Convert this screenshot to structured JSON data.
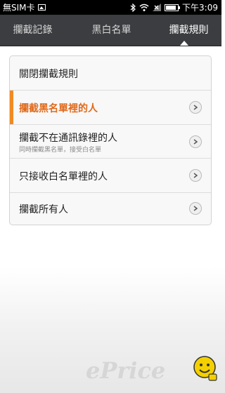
{
  "status_bar": {
    "carrier": "無SIM卡",
    "time": "下午3:09",
    "icons": [
      "image-icon",
      "bluetooth-icon",
      "wifi-icon",
      "signal-icon",
      "battery-icon"
    ]
  },
  "tabs": [
    {
      "label": "攔截記錄",
      "active": false
    },
    {
      "label": "黑白名單",
      "active": false
    },
    {
      "label": "攔截規則",
      "active": true
    }
  ],
  "rules": {
    "items": [
      {
        "label": "關閉攔截規則",
        "subtitle": "",
        "selected": false
      },
      {
        "label": "攔截黑名單裡的人",
        "subtitle": "",
        "selected": true
      },
      {
        "label": "攔截不在通訊錄裡的人",
        "subtitle": "同時攔截黑名單，接受白名單",
        "selected": false
      },
      {
        "label": "只接收白名單裡的人",
        "subtitle": "",
        "selected": false
      },
      {
        "label": "攔截所有人",
        "subtitle": "",
        "selected": false
      }
    ]
  },
  "watermark": {
    "text": "ePrice"
  },
  "colors": {
    "accent": "#f08a22",
    "selected_text": "#e06a1b",
    "tabbar": "#3b3d40"
  }
}
